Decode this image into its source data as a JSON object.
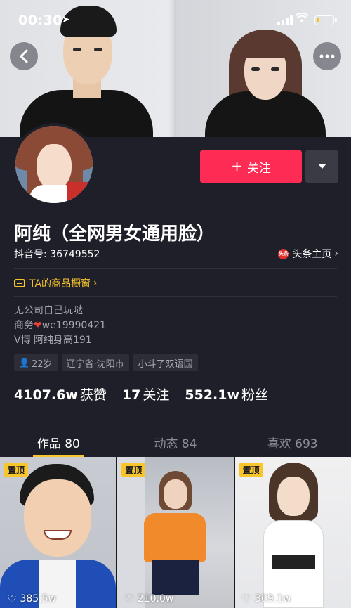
{
  "status_bar": {
    "time": "00:30",
    "location_icon": "location-arrow-icon",
    "battery_level_percent": 20
  },
  "nav": {
    "back_icon": "chevron-left-icon",
    "more_icon": "more-dots-icon"
  },
  "profile": {
    "follow_label": "关注",
    "name": "阿纯（全网男女通用脸）",
    "douyin_id": "抖音号: 36749552",
    "toutiao_badge": "头条",
    "toutiao_label": "头条主页",
    "shop_label": "TA的商品橱窗",
    "bio": {
      "line1": "无公司自己玩哒",
      "line2_prefix": "商务",
      "line2_suffix": "we19990421",
      "line3": "V博 阿纯身高191"
    },
    "tags": {
      "age": "22岁",
      "location": "辽宁省·沈阳市",
      "school": "小斗了双语园"
    },
    "stats": {
      "likes_num": "4107.6w",
      "likes_label": "获赞",
      "following_num": "17",
      "following_label": "关注",
      "fans_num": "552.1w",
      "fans_label": "粉丝"
    }
  },
  "tabs": [
    {
      "label": "作品 80",
      "active": true
    },
    {
      "label": "动态 84",
      "active": false
    },
    {
      "label": "喜欢 693",
      "active": false
    }
  ],
  "videos": [
    {
      "pin": "置顶",
      "likes": "385.5w"
    },
    {
      "pin": "置顶",
      "likes": "210.0w"
    },
    {
      "pin": "置顶",
      "likes": "309.1w"
    }
  ],
  "colors": {
    "accent_red": "#fe2c55",
    "accent_yellow": "#f8c62a",
    "background": "#1e1f29"
  }
}
